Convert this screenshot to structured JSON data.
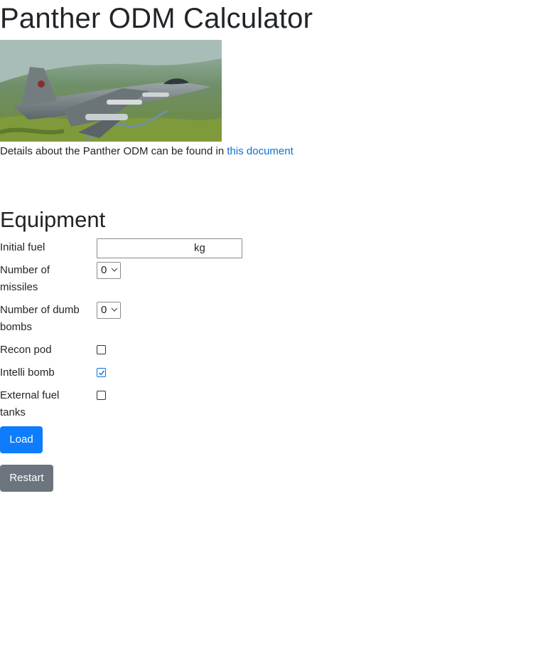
{
  "page": {
    "title": "Panther ODM Calculator",
    "details_prefix": "Details about the Panther ODM can be found in",
    "details_link": "this document"
  },
  "equipment": {
    "heading": "Equipment",
    "initial_fuel": {
      "label": "Initial fuel",
      "value": "",
      "unit": "kg"
    },
    "missiles": {
      "label": "Number of missiles",
      "selected": "0"
    },
    "dumb_bombs": {
      "label": "Number of dumb bombs",
      "selected": "0"
    },
    "recon_pod": {
      "label": "Recon pod",
      "checked": false
    },
    "intelli_bomb": {
      "label": "Intelli bomb",
      "checked": true
    },
    "external_fuel_tanks": {
      "label": "External fuel tanks",
      "checked": false
    }
  },
  "actions": {
    "load_label": "Load",
    "restart_label": "Restart"
  },
  "colors": {
    "link": "#0b6fd6",
    "primary_button": "#0d7dfd",
    "secondary_button": "#6c757d",
    "text": "#212529"
  }
}
